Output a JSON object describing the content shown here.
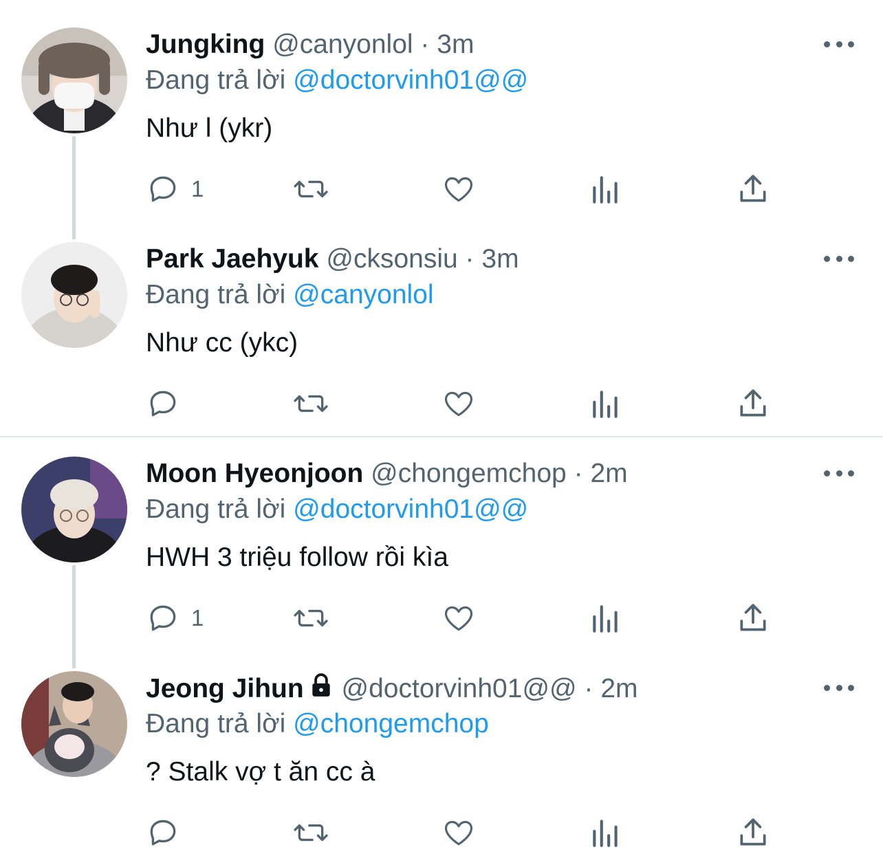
{
  "colors": {
    "accent": "#1d9bf0",
    "muted": "#536471",
    "text": "#0f1419"
  },
  "tweets": [
    {
      "name": "Jungking",
      "handle": "@canyonlol",
      "time": "3m",
      "locked": false,
      "replying_label": "Đang trả lời",
      "replying_to": "@doctorvinh01@@",
      "text": "Như l (ykr)",
      "reply_count": "1",
      "thread_line": true
    },
    {
      "name": "Park Jaehyuk",
      "handle": "@cksonsiu",
      "time": "3m",
      "locked": false,
      "replying_label": "Đang trả lời",
      "replying_to": "@canyonlol",
      "text": "Như cc (ykc)",
      "reply_count": "",
      "thread_line": false
    },
    {
      "name": "Moon Hyeonjoon",
      "handle": "@chongemchop",
      "time": "2m",
      "locked": false,
      "replying_label": "Đang trả lời",
      "replying_to": "@doctorvinh01@@",
      "text": "HWH 3 triệu follow rồi kìa",
      "reply_count": "1",
      "thread_line": true
    },
    {
      "name": "Jeong Jihun",
      "handle": "@doctorvinh01@@",
      "time": "2m",
      "locked": true,
      "replying_label": "Đang trả lời",
      "replying_to": "@chongemchop",
      "text": "? Stalk vợ t ăn cc à",
      "reply_count": "",
      "thread_line": false
    }
  ],
  "icons": {
    "reply": "reply-icon",
    "retweet": "retweet-icon",
    "like": "heart-icon",
    "analytics": "analytics-icon",
    "share": "share-icon",
    "more": "more-icon",
    "lock": "lock-icon"
  }
}
